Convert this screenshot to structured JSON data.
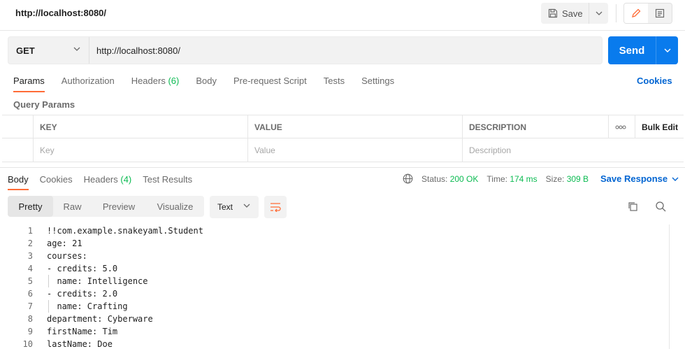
{
  "tab": {
    "title": "http://localhost:8080/"
  },
  "toolbar": {
    "save_label": "Save"
  },
  "request": {
    "method": "GET",
    "url": "http://localhost:8080/",
    "send_label": "Send"
  },
  "request_tabs": [
    {
      "label": "Params"
    },
    {
      "label": "Authorization"
    },
    {
      "label": "Headers",
      "count": "(6)"
    },
    {
      "label": "Body"
    },
    {
      "label": "Pre-request Script"
    },
    {
      "label": "Tests"
    },
    {
      "label": "Settings"
    }
  ],
  "cookies_label": "Cookies",
  "query_params": {
    "title": "Query Params",
    "columns": {
      "key": "KEY",
      "value": "VALUE",
      "description": "DESCRIPTION",
      "more": "ooo",
      "bulk_edit": "Bulk Edit"
    },
    "placeholders": {
      "key": "Key",
      "value": "Value",
      "description": "Description"
    }
  },
  "response": {
    "tabs": [
      {
        "label": "Body"
      },
      {
        "label": "Cookies"
      },
      {
        "label": "Headers",
        "count": "(4)"
      },
      {
        "label": "Test Results"
      }
    ],
    "status_label": "Status:",
    "status_value": "200 OK",
    "time_label": "Time:",
    "time_value": "174 ms",
    "size_label": "Size:",
    "size_value": "309 B",
    "save_response_label": "Save Response",
    "views": [
      "Pretty",
      "Raw",
      "Preview",
      "Visualize"
    ],
    "format": "Text",
    "lines": [
      {
        "n": "1",
        "text": "!!com.example.snakeyaml.Student"
      },
      {
        "n": "2",
        "text": "age: 21"
      },
      {
        "n": "3",
        "text": "courses:"
      },
      {
        "n": "4",
        "text": "- credits: 5.0"
      },
      {
        "n": "5",
        "text": "  name: Intelligence"
      },
      {
        "n": "6",
        "text": "- credits: 2.0"
      },
      {
        "n": "7",
        "text": "  name: Crafting"
      },
      {
        "n": "8",
        "text": "department: Cyberware"
      },
      {
        "n": "9",
        "text": "firstName: Tim"
      },
      {
        "n": "10",
        "text": "lastName: Doe"
      }
    ]
  },
  "colors": {
    "accent": "#ff6c37",
    "send": "#097bed",
    "link": "#0265d2",
    "ok": "#0cbb52"
  }
}
